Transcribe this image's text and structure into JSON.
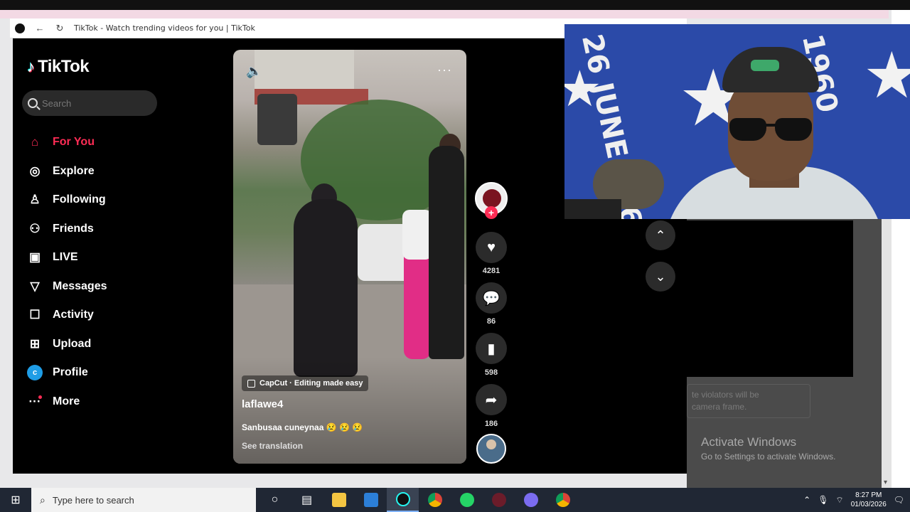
{
  "browser": {
    "tab_title": "TikTok - Watch trending videos for you | TikTok"
  },
  "tiktok": {
    "logo_text": "TikTok",
    "search_placeholder": "Search",
    "nav": [
      {
        "label": "For You",
        "icon": "home-icon",
        "active": true
      },
      {
        "label": "Explore",
        "icon": "compass-icon"
      },
      {
        "label": "Following",
        "icon": "user-follow-icon"
      },
      {
        "label": "Friends",
        "icon": "friends-icon"
      },
      {
        "label": "LIVE",
        "icon": "live-icon"
      },
      {
        "label": "Messages",
        "icon": "send-icon"
      },
      {
        "label": "Activity",
        "icon": "message-box-icon"
      },
      {
        "label": "Upload",
        "icon": "upload-icon"
      },
      {
        "label": "Profile",
        "icon": "profile-avatar",
        "avatar_letter": "c"
      },
      {
        "label": "More",
        "icon": "more-icon"
      }
    ],
    "video": {
      "capcut_label": "CapCut · Editing made easy",
      "username": "laflawe4",
      "caption": "Sanbusaa cuneynaa",
      "caption_emojis": "😢 😢 😢",
      "see_translation": "See translation"
    },
    "actions": {
      "likes": "4281",
      "comments": "86",
      "saves": "598",
      "shares": "186"
    }
  },
  "overlay": {
    "faint_text_1": "te violators will be",
    "faint_text_2": "camera frame.",
    "activate_title": "Activate Windows",
    "activate_sub": "Go to Settings to activate Windows."
  },
  "webcam": {
    "flag_text_1": "26 JUNE 1960",
    "flag_text_2": "1960"
  },
  "taskbar": {
    "search_placeholder": "Type here to search",
    "time": "8:27 PM",
    "date": "01/03/2026"
  },
  "colors": {
    "accent": "#fe2c55",
    "taskbar": "#202734"
  }
}
